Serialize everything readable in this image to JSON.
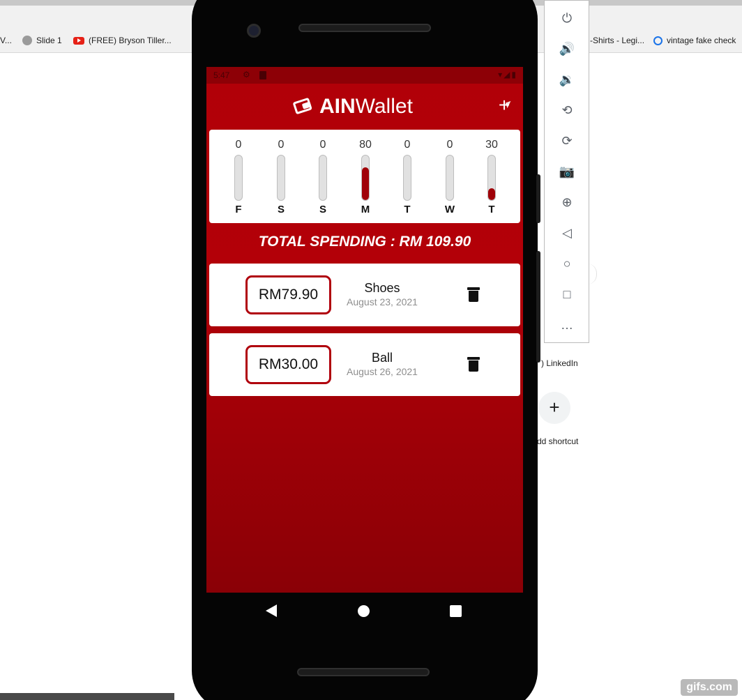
{
  "browser": {
    "bookmarks": [
      {
        "label": "V..."
      },
      {
        "label": "Slide 1"
      },
      {
        "label": "(FREE) Bryson Tiller..."
      },
      {
        "label": "-Shirts - Legi..."
      },
      {
        "label": "vintage fake check"
      }
    ],
    "shortcuts": {
      "linkedin_label": ") LinkedIn",
      "add_label": "dd shortcut",
      "add_symbol": "+"
    }
  },
  "phone": {
    "status_bar": {
      "time": "5:47",
      "icons_right": "▾◢▮"
    },
    "app": {
      "title_bold": "AIN",
      "title_rest": "Wallet",
      "add_symbol": "+",
      "chart": {
        "days": [
          {
            "label": "F",
            "value": "0",
            "fill": 0.0
          },
          {
            "label": "S",
            "value": "0",
            "fill": 0.0
          },
          {
            "label": "S",
            "value": "0",
            "fill": 0.0
          },
          {
            "label": "M",
            "value": "80",
            "fill": 0.73
          },
          {
            "label": "T",
            "value": "0",
            "fill": 0.0
          },
          {
            "label": "W",
            "value": "0",
            "fill": 0.0
          },
          {
            "label": "T",
            "value": "30",
            "fill": 0.27
          }
        ]
      },
      "total_spending": "TOTAL SPENDING : RM 109.90",
      "expenses": [
        {
          "amount": "RM79.90",
          "name": "Shoes",
          "date": "August 23, 2021"
        },
        {
          "amount": "RM30.00",
          "name": "Ball",
          "date": "August 26, 2021"
        }
      ]
    }
  },
  "emulator_toolbar": {
    "buttons": [
      {
        "icon": "power-icon",
        "glyph": "⏻"
      },
      {
        "icon": "volume-up-icon",
        "glyph": "🔊"
      },
      {
        "icon": "volume-down-icon",
        "glyph": "🔉"
      },
      {
        "icon": "rotate-left-icon",
        "glyph": "⟲"
      },
      {
        "icon": "rotate-right-icon",
        "glyph": "⟳"
      },
      {
        "icon": "camera-icon",
        "glyph": "📷"
      },
      {
        "icon": "zoom-icon",
        "glyph": "⊕"
      },
      {
        "icon": "back-icon",
        "glyph": "◁"
      },
      {
        "icon": "home-icon",
        "glyph": "○"
      },
      {
        "icon": "overview-icon",
        "glyph": "□"
      },
      {
        "icon": "more-icon",
        "glyph": "…"
      }
    ]
  },
  "watermark": "gifs.com",
  "colors": {
    "accent": "#b10008",
    "dark_red": "#8d0006",
    "card": "#ffffff"
  }
}
